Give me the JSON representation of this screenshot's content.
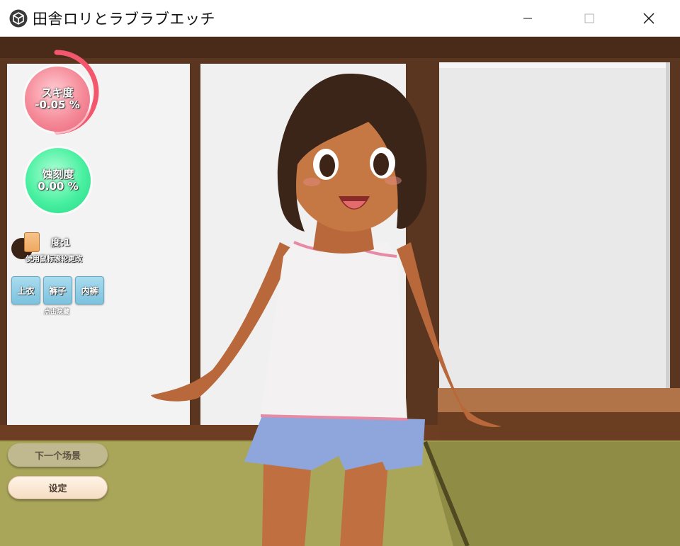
{
  "window": {
    "title": "田舎ロリとラブラブエッチ",
    "icon": "unity-cube-icon",
    "controls": {
      "minimize": "minimize-icon",
      "maximize": "maximize-icon",
      "close": "close-icon"
    }
  },
  "hud": {
    "like_meter": {
      "label": "スキ度",
      "value": "-0.05 %",
      "color": "#f58a98",
      "ring_color": "#f2576e"
    },
    "erosion_meter": {
      "label": "蚀刻度",
      "value": "0.00 %",
      "color": "#48f0a0"
    },
    "color_control": {
      "value_label": "度:1",
      "hint": "使用鼠标滚轮更改",
      "dark_color": "#3b2415",
      "skin_color": "#f0ae6a"
    },
    "clothing_buttons": [
      "上衣",
      "裤子",
      "内裤"
    ],
    "clothing_hint": "点击隐藏",
    "next_scene_button": "下一个场景",
    "settings_button": "设定"
  }
}
